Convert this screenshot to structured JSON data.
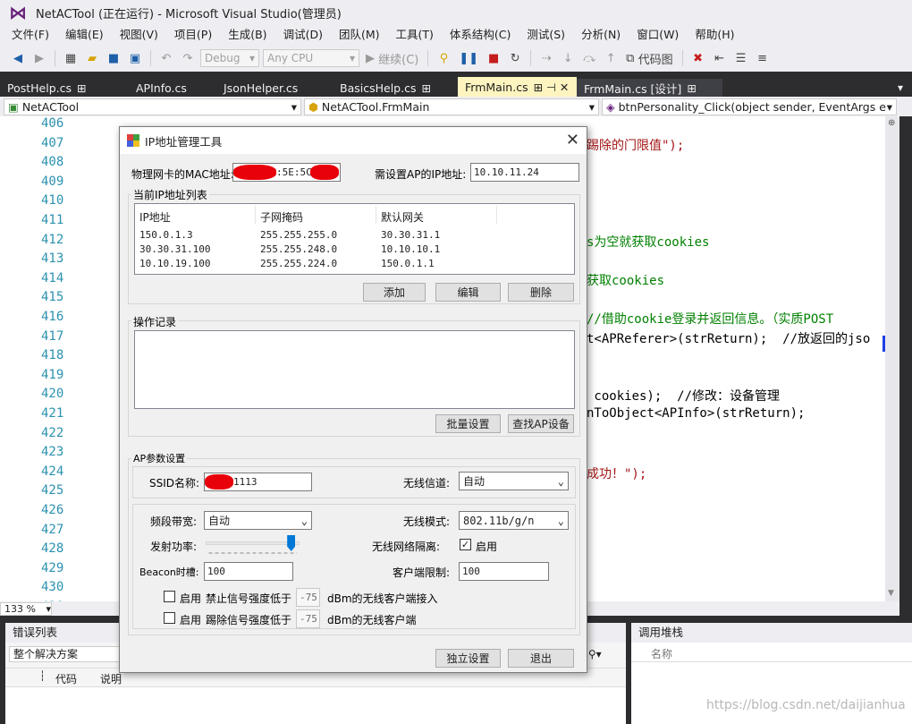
{
  "window": {
    "title": "NetACTool (正在运行) - Microsoft Visual Studio(管理员)"
  },
  "menu": [
    "文件(F)",
    "编辑(E)",
    "视图(V)",
    "项目(P)",
    "生成(B)",
    "调试(D)",
    "团队(M)",
    "工具(T)",
    "体系结构(C)",
    "测试(S)",
    "分析(N)",
    "窗口(W)",
    "帮助(H)"
  ],
  "toolbar": {
    "config": "Debug",
    "platform": "Any CPU",
    "continue": "继续(C)",
    "codemap": "代码图"
  },
  "tabs": [
    {
      "label": "PostHelp.cs",
      "pin": "⊞"
    },
    {
      "label": "APInfo.cs",
      "pin": ""
    },
    {
      "label": "JsonHelper.cs",
      "pin": ""
    },
    {
      "label": "BasicsHelp.cs",
      "pin": "⊞"
    },
    {
      "label": "FrmMain.cs",
      "pin": "⊞ ⊣ ✕"
    },
    {
      "label": "FrmMain.cs [设计]",
      "pin": "⊞"
    }
  ],
  "nav": {
    "project": "NetACTool",
    "class": "NetACTool.FrmMain",
    "member": "btnPersonality_Click(object sender, EventArgs e)"
  },
  "editor": {
    "line_numbers": [
      "406",
      "407",
      "408",
      "409",
      "410",
      "411",
      "412",
      "413",
      "414",
      "415",
      "416",
      "417",
      "418",
      "419",
      "420",
      "421",
      "422",
      "423",
      "424",
      "425",
      "426",
      "427",
      "428",
      "429",
      "430",
      "431"
    ],
    "code": [
      {
        "text": "踢除的门限值\");",
        "color": "#a31515",
        "row": 1
      },
      {
        "text": "s为空就获取cookies",
        "color": "#008000",
        "row": 6
      },
      {
        "text": "获取cookies",
        "color": "#008000",
        "row": 8
      },
      {
        "text": "//借助cookie登录并返回信息。（实质POST",
        "color": "#008000",
        "row": 10
      },
      {
        "text": "t<APReferer>(strReturn);  //放返回的jso",
        "color": "#000000",
        "row": 11
      },
      {
        "text": " cookies);  //修改：设备管理",
        "color": "#000000",
        "row": 14
      },
      {
        "text": "nToObject<APInfo>(strReturn);",
        "color": "#000000",
        "row": 15
      },
      {
        "text": "成功！\");",
        "color": "#a31515",
        "row": 18
      }
    ],
    "zoom": "133 %"
  },
  "error_panel": {
    "title": "错误列表",
    "scope": "整个解决方案",
    "col_code": "代码",
    "col_desc": "说明",
    "side": "表"
  },
  "callstack_panel": {
    "title": "调用堆栈",
    "col_name": "名称"
  },
  "dialog": {
    "title": "IP地址管理工具",
    "mac_label": "物理网卡的MAC地址:",
    "mac_value": ":5E:5C",
    "ap_ip_label": "需设置AP的IP地址:",
    "ap_ip_value": "10.10.11.24",
    "ip_list_group": "当前IP地址列表",
    "ip_columns": [
      "IP地址",
      "子网掩码",
      "默认网关"
    ],
    "ip_rows": [
      [
        "150.0.1.3",
        "255.255.255.0",
        "30.30.31.1"
      ],
      [
        "30.30.31.100",
        "255.255.248.0",
        "10.10.10.1"
      ],
      [
        "10.10.19.100",
        "255.255.224.0",
        "150.0.1.1"
      ]
    ],
    "btn_add": "添加",
    "btn_edit": "编辑",
    "btn_delete": "删除",
    "log_group": "操作记录",
    "btn_batch": "批量设置",
    "btn_find_ap": "查找AP设备",
    "ap_group": "AP参数设置",
    "ssid_label": "SSID名称:",
    "ssid_value": "1113",
    "channel_label": "无线信道:",
    "channel_value": "自动",
    "bandwidth_label": "频段带宽:",
    "bandwidth_value": "自动",
    "mode_label": "无线模式:",
    "mode_value": "802.11b/g/n",
    "power_label": "发射功率:",
    "power_level": 0.95,
    "isolation_label": "无线网络隔离:",
    "isolation_enabled_label": "启用",
    "beacon_label": "Beacon时槽:",
    "beacon_value": "100",
    "client_limit_label": "客户端限制:",
    "client_limit_value": "100",
    "enable_label": "启用",
    "deny_label": "禁止信号强度低于",
    "deny_value": "-75",
    "deny_suffix": "dBm的无线客户端接入",
    "kick_label": "踢除信号强度低于",
    "kick_value": "-75",
    "kick_suffix": "dBm的无线客户端",
    "btn_standalone": "独立设置",
    "btn_exit": "退出"
  },
  "watermark": "https://blog.csdn.net/daijianhua",
  "colors": {
    "accent": "#007acc",
    "tab_active": "#fdf4bf",
    "line_number": "#2b91af",
    "redact": "#e8000b"
  }
}
